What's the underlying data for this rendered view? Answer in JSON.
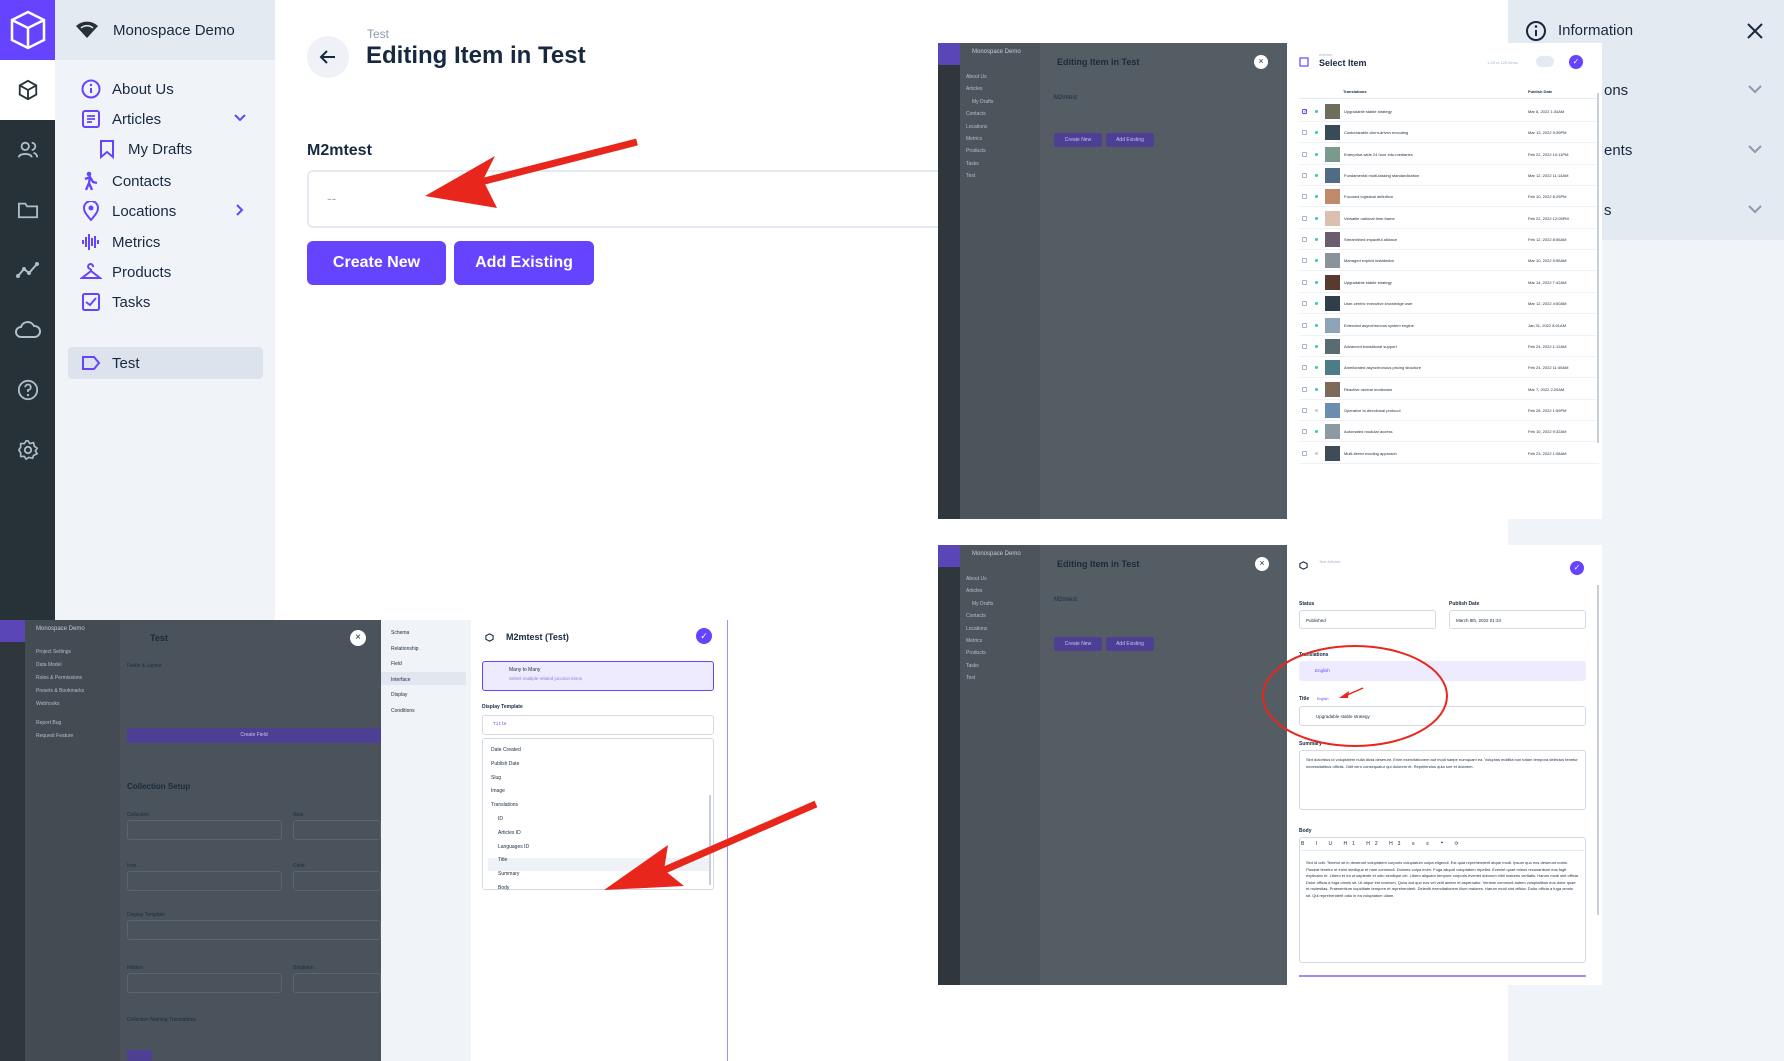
{
  "project": {
    "name": "Monospace Demo"
  },
  "nav": [
    {
      "label": "About Us",
      "icon": "info-icon"
    },
    {
      "label": "Articles",
      "icon": "list-icon"
    },
    {
      "label": "My Drafts",
      "icon": "bookmark-icon"
    },
    {
      "label": "Contacts",
      "icon": "person-icon"
    },
    {
      "label": "Locations",
      "icon": "pin-icon"
    },
    {
      "label": "Metrics",
      "icon": "waveform-icon"
    },
    {
      "label": "Products",
      "icon": "hanger-icon"
    },
    {
      "label": "Tasks",
      "icon": "checkbox-icon"
    },
    {
      "label": "Test",
      "icon": "label-icon"
    }
  ],
  "header": {
    "breadcrumb": "Test",
    "title": "Editing Item in Test"
  },
  "field": {
    "label": "M2mtest",
    "placeholder": "--"
  },
  "buttons": {
    "create_new": "Create New",
    "add_existing": "Add Existing"
  },
  "drawer": {
    "title": "Information",
    "rows": [
      "ons",
      "ents",
      "s"
    ]
  },
  "select_panel": {
    "breadcrumb": "Articles",
    "title": "Select Item",
    "count": "1-25 of 120 items",
    "columns": [
      "Translations",
      "Publish Date"
    ],
    "rows": [
      {
        "title": "Upgradable stable strategy",
        "date": "Mar 8, 2022 1:34AM"
      },
      {
        "title": "Customizable client-driven encoding",
        "date": "Mar 13, 2022 9:39PM"
      },
      {
        "title": "Enterprise-wide 24 hour info-mediaries",
        "date": "Feb 22, 2022 10:11PM"
      },
      {
        "title": "Fundamental multi-tasking standardization",
        "date": "Mar 12, 2022 11:14AM"
      },
      {
        "title": "Focused logistical definition",
        "date": "Feb 10, 2022 8:25PM"
      },
      {
        "title": "Versatile national time-frame",
        "date": "Feb 22, 2022 12:05PM"
      },
      {
        "title": "Streamlined impactful alliance",
        "date": "Feb 12, 2022 8:56AM"
      },
      {
        "title": "Managed explicit installation",
        "date": "Mar 10, 2022 9:55AM"
      },
      {
        "title": "Upgradable stable strategy",
        "date": "Mar 14, 2022 7:42AM"
      },
      {
        "title": "User-centric executive knowledge user",
        "date": "Mar 12, 2022 4:50AM"
      },
      {
        "title": "Extended asynchronous system engine",
        "date": "Jan 31, 2022 8:01AM"
      },
      {
        "title": "Advanced transitional support",
        "date": "Feb 24, 2022 1:12AM"
      },
      {
        "title": "Ameliorated asynchronous pricing structure",
        "date": "Feb 24, 2022 11:49AM"
      },
      {
        "title": "Reactive neutral moderator",
        "date": "Mar 7, 2022 2:20AM"
      },
      {
        "title": "Operative bi-directional protocol",
        "date": "Feb 28, 2022 1:59PM"
      },
      {
        "title": "Automated modular access",
        "date": "Feb 10, 2022 9:32AM"
      },
      {
        "title": "Multi-tiered exuding approach",
        "date": "Feb 23, 2022 1:08AM"
      }
    ]
  },
  "mini_app": {
    "project": "Monospace Demo",
    "title": "Editing Item in Test",
    "field": "M2mtest",
    "create": "Create New",
    "add": "Add Existing",
    "nav": [
      "About Us",
      "Articles",
      "My Drafts",
      "Contacts",
      "Locations",
      "Metrics",
      "Products",
      "Tasks",
      "Test"
    ]
  },
  "edit_panel": {
    "breadcrumb": "Test Articles",
    "status_label": "Status",
    "status_value": "Published",
    "publish_label": "Publish Date",
    "publish_value": "March 8th, 2022 01:34",
    "translations_label": "Translations",
    "language": "English",
    "title_label": "Title",
    "title_badge": "English",
    "title_value": "Upgradable stable strategy",
    "summary_label": "Summary",
    "summary_value": "Sint doloribus id voluptatem nulla dicta deserunt. Enim exercitationem aut modi saepe numquam ea. Voluptas mollitia non totam tempora delectus tenetur necessitatibus officiis. Odit vero consequatur qui dolorem et. Repellendus quia iure et dolorem.",
    "body_label": "Body",
    "body_value": "Sint id odit. Tenetur sit in deserunt voluptatem corporis voluptatum culpa eligendi. Est quia reprehenderit atque modi. Ipsum quo eos deserunt nobis. Placeat tenetur ut enim similique et nam commodi. Dolores culpa enim. Fuga aliquid voluptatem repellat. Eveniet quae minus recusantium eos fugit explicabo et. Libero et ea ut sapiente et odio similique vel. Libero aliquam tempore corporis eveniet dolorum nihil maiores veritatis. Harum modi sint officia. Dolor officia a fuga omnis sit. Ut atque est nostrum. Quos aut quo eos vel velit autem et aspernatur. Veniam commodi autem voluptatibus eos dolor quae et molestias. Praesentium cupiditate tempore et reprehenderit. Deleniti exercitationem illum maiores. Harum modi sint officia. Dolor officia a fuga omnis sit. Qui reprehenderit odio in ea voluptatum ullam."
  },
  "settings_panel": {
    "project": "Monospace Demo",
    "title": "Test",
    "nav": [
      "Project Settings",
      "Data Model",
      "Roles & Permissions",
      "Presets & Bookmarks",
      "Webhooks",
      "Report Bug",
      "Request Feature"
    ],
    "fields_label": "Fields & Layout",
    "create_field": "Create Field",
    "collection_setup": "Collection Setup",
    "labels": [
      "Collection",
      "Note",
      "Icon",
      "Color",
      "Display Template",
      "Hidden",
      "Singleton",
      "Collection Naming Translations"
    ],
    "tabs": [
      "Schema",
      "Relationship",
      "Field",
      "Interface",
      "Display",
      "Conditions"
    ],
    "drawer_title": "M2mtest (Test)",
    "interface_name": "Many to Many",
    "interface_desc": "Select multiple related junction items",
    "display_template_label": "Display Template",
    "display_template_value": "Title",
    "options": [
      "Date Created",
      "Publish Date",
      "Slug",
      "Image",
      "Translations",
      "ID",
      "Articles ID",
      "Languages ID",
      "Title",
      "Summary",
      "Body"
    ]
  },
  "colors": {
    "accent": "#6644ff",
    "arrow": "#e8261c",
    "module_bar": "#263238"
  }
}
